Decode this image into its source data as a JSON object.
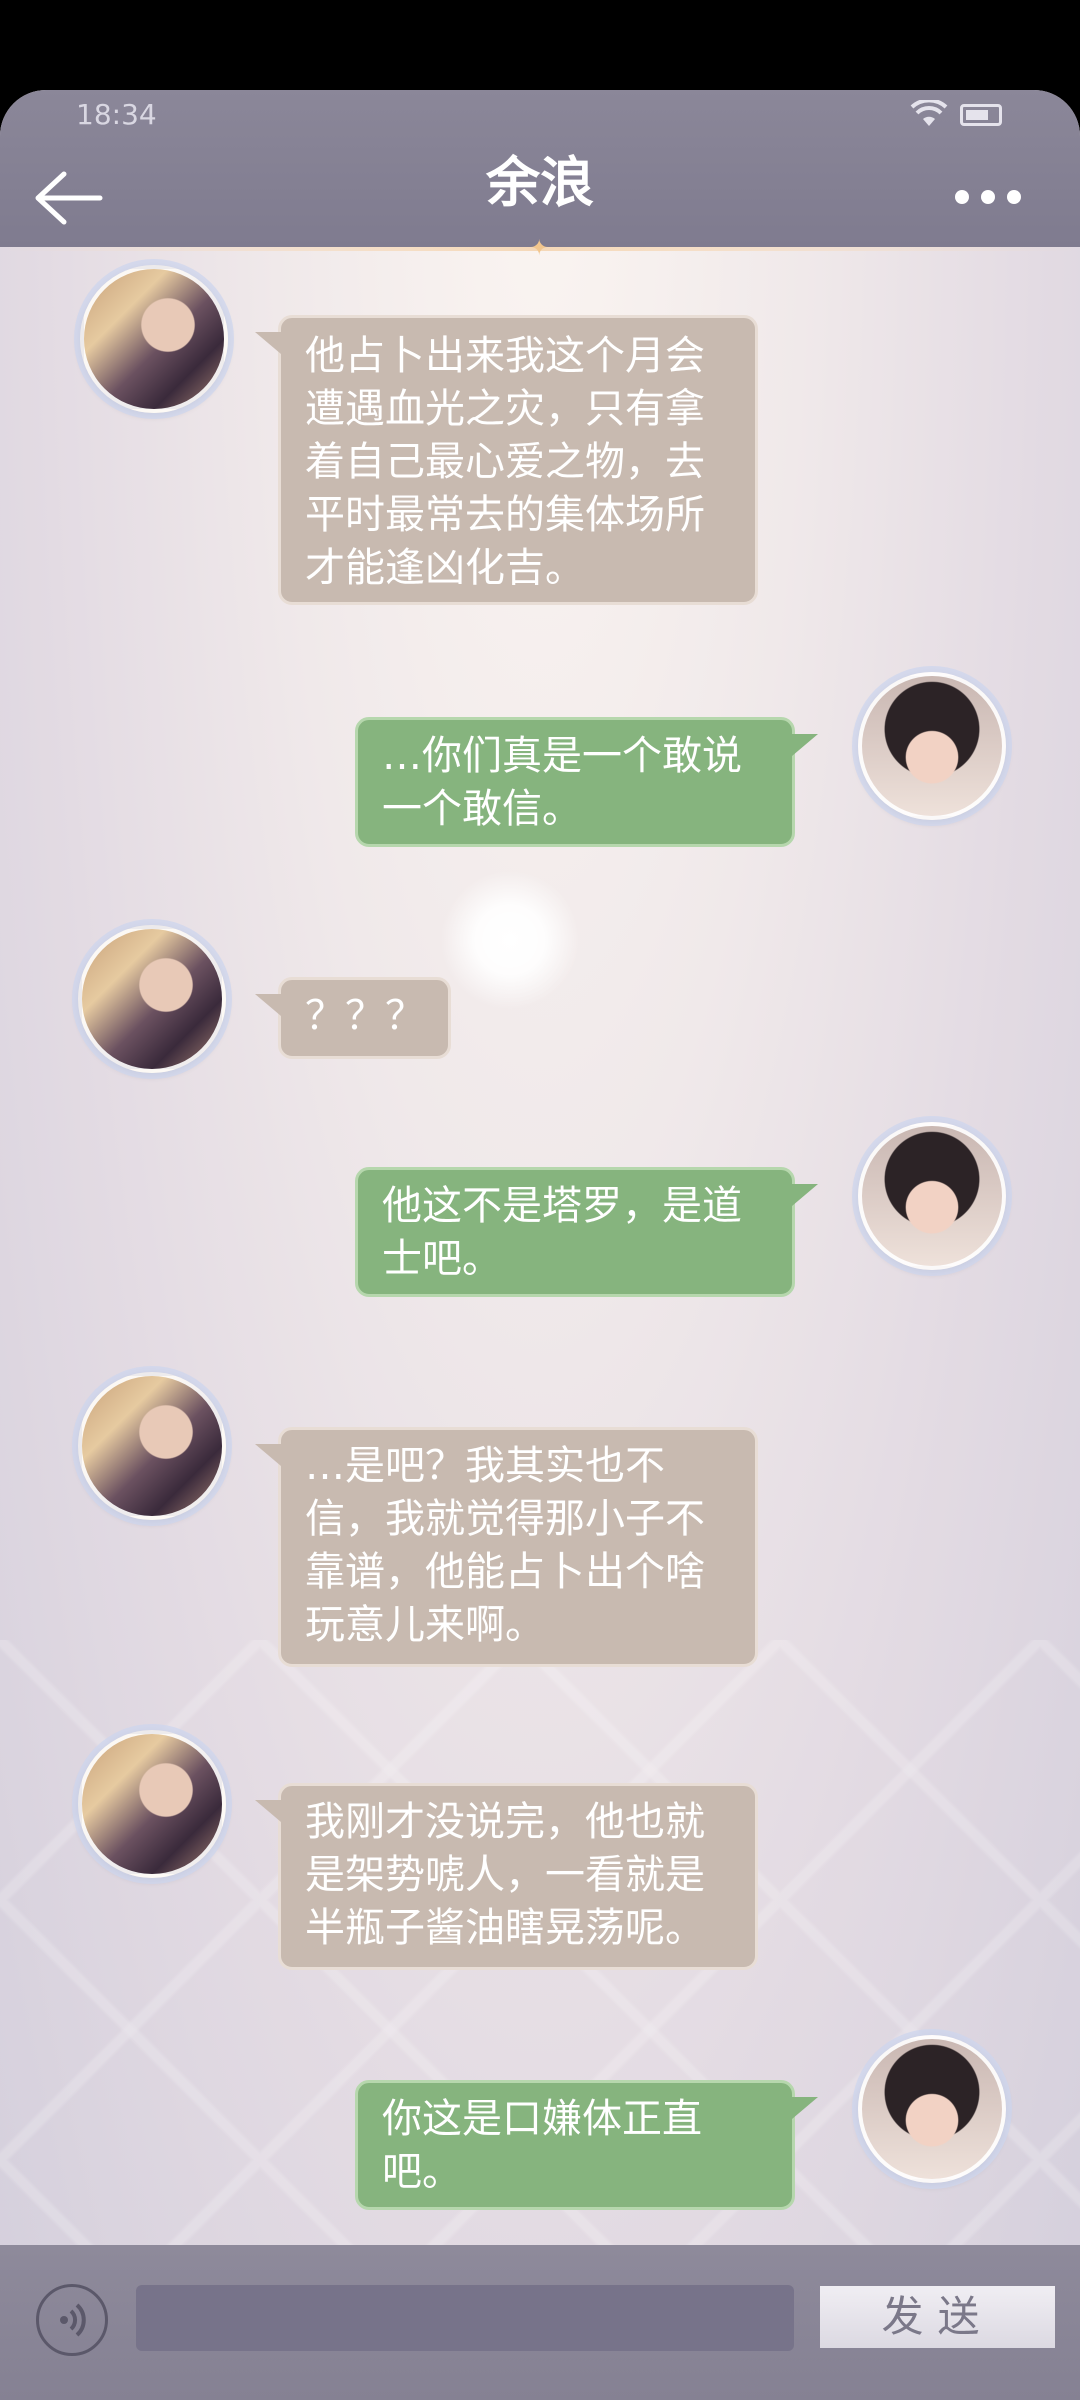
{
  "status_bar": {
    "time": "18:34"
  },
  "header": {
    "title": "余浪"
  },
  "messages": [
    {
      "side": "left",
      "text": "他占卜出来我这个月会遭遇血光之灾，只有拿着自己最心爱之物，去平时最常去的集体场所才能逢凶化吉。"
    },
    {
      "side": "right",
      "text": "…你们真是一个敢说一个敢信。"
    },
    {
      "side": "left",
      "text": "？？？"
    },
    {
      "side": "right",
      "text": "他这不是塔罗，是道士吧。"
    },
    {
      "side": "left",
      "text": "…是吧？我其实也不信，我就觉得那小子不靠谱，他能占卜出个啥玩意儿来啊。"
    },
    {
      "side": "left",
      "text": "我刚才没说完，他也就是架势唬人，一看就是半瓶子酱油瞎晃荡呢。"
    },
    {
      "side": "right",
      "text": "你这是口嫌体正直吧。"
    }
  ],
  "input": {
    "placeholder": "",
    "send_label": "发送"
  },
  "icons": {
    "back": "back-arrow-icon",
    "more": "more-dots-icon",
    "voice": "voice-icon"
  }
}
